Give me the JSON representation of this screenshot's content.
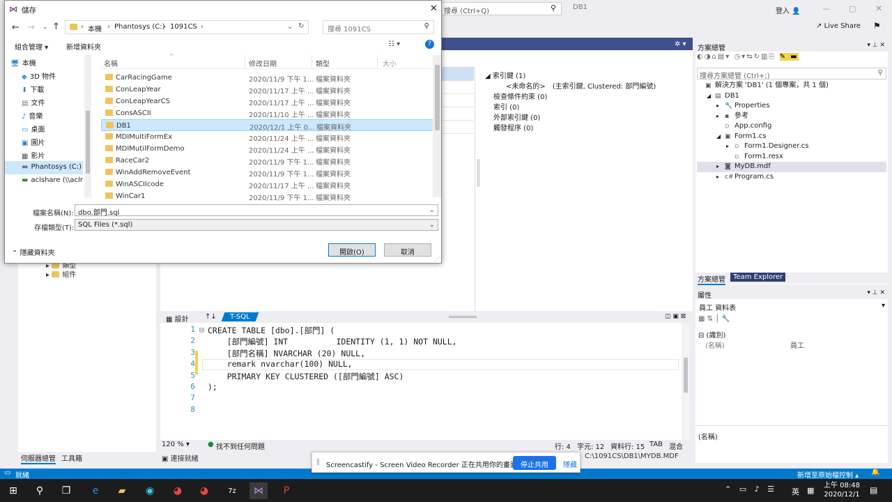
{
  "vs": {
    "search_placeholder": "搜尋 (Ctrl+Q)",
    "db_tab": "DB1",
    "login": "登入",
    "live_share": "Live Share",
    "left_tree": [
      "類型",
      "組件"
    ],
    "left_tabs": [
      "伺服器總管",
      "工具箱"
    ],
    "indexes": [
      "索引鍵 (1)",
      "<未命名的>　(主索引鍵, Clustered: 部門編號)",
      "檢查條件約束 (0)",
      "索引 (0)",
      "外部索引鍵 (0)",
      "觸發程序 (0)"
    ],
    "bottom_tabs": {
      "design": "設計",
      "swap": "↑↓",
      "tsql": "T-SQL"
    },
    "code_lines": [
      {
        "n": "1",
        "t": "CREATE TABLE [dbo].[部門] ("
      },
      {
        "n": "2",
        "t": "    [部門編號] INT          IDENTITY (1, 1) NOT NULL,"
      },
      {
        "n": "3",
        "t": "    [部門名稱] NVARCHAR (20) NULL,"
      },
      {
        "n": "4",
        "t": "    remark nvarchar(100) NULL,"
      },
      {
        "n": "5",
        "t": "    PRIMARY KEY CLUSTERED ([部門編號] ASC)"
      },
      {
        "n": "6",
        "t": ");"
      },
      {
        "n": "7",
        "t": ""
      },
      {
        "n": "8",
        "t": ""
      }
    ],
    "code_status": {
      "zoom": "120 %",
      "issues": "找不到任何問題",
      "line": "行: 4",
      "char": "字元: 12",
      "col": "資料行: 15",
      "tab": "TAB",
      "mixed": "混合"
    },
    "connect_ready": "連接就緒",
    "path": "C:\\1091CS\\DB1\\MYDB.MDF",
    "solution_title": "方案總管",
    "solution_search": "搜尋方案總管 (Ctrl+;)",
    "solution_tree": [
      {
        "label": "解決方案 'DB1' (1 個專案，共 1 個)",
        "lvl": 0
      },
      {
        "label": "DB1",
        "lvl": 1
      },
      {
        "label": "Properties",
        "lvl": 2
      },
      {
        "label": "參考",
        "lvl": 2
      },
      {
        "label": "App.config",
        "lvl": 2
      },
      {
        "label": "Form1.cs",
        "lvl": 2
      },
      {
        "label": "Form1.Designer.cs",
        "lvl": 3
      },
      {
        "label": "Form1.resx",
        "lvl": 3
      },
      {
        "label": "MyDB.mdf",
        "lvl": 2
      },
      {
        "label": "Program.cs",
        "lvl": 2
      }
    ],
    "solution_tabs": [
      "方案總管",
      "Team Explorer"
    ],
    "props_title": "屬性",
    "props_object": "員工 資料表",
    "props_category": "(識別)",
    "props_name_key": "(名稱)",
    "props_name_val": "員工",
    "props_desc": "(名稱)",
    "status": {
      "ready": "就緒",
      "add_source": "新增至原始檔控制"
    }
  },
  "dialog": {
    "title": "儲存",
    "breadcrumb": [
      "本機",
      "Phantosys (C:)",
      "1091CS"
    ],
    "search_placeholder": "搜尋 1091CS",
    "organize": "組合管理",
    "new_folder": "新增資料夾",
    "nav": [
      "本機",
      "3D 物件",
      "下載",
      "文件",
      "音樂",
      "桌面",
      "圖片",
      "影片",
      "Phantosys (C:)",
      "aclshare (\\\\acln"
    ],
    "columns": {
      "name": "名稱",
      "date": "修改日期",
      "type": "類型",
      "size": "大小"
    },
    "files": [
      {
        "name": "CarRacingGame",
        "date": "2020/11/9 下午 1...",
        "type": "檔案資料夾"
      },
      {
        "name": "ConLeapYear",
        "date": "2020/11/17 上午 ...",
        "type": "檔案資料夾"
      },
      {
        "name": "ConLeapYearCS",
        "date": "2020/11/17 上午 ...",
        "type": "檔案資料夾"
      },
      {
        "name": "ConsASCII",
        "date": "2020/11/10 上午 ...",
        "type": "檔案資料夾"
      },
      {
        "name": "DB1",
        "date": "2020/12/1 上午 0...",
        "type": "檔案資料夾"
      },
      {
        "name": "MDIMultiFormEx",
        "date": "2020/11/24 上午 ...",
        "type": "檔案資料夾"
      },
      {
        "name": "MDIMutilFormDemo",
        "date": "2020/11/24 上午 ...",
        "type": "檔案資料夾"
      },
      {
        "name": "RaceCar2",
        "date": "2020/11/9 下午 1...",
        "type": "檔案資料夾"
      },
      {
        "name": "WinAddRemoveEvent",
        "date": "2020/11/9 下午 1...",
        "type": "檔案資料夾"
      },
      {
        "name": "WinASCIIcode",
        "date": "2020/11/17 上午 ...",
        "type": "檔案資料夾"
      },
      {
        "name": "WinCar1",
        "date": "2020/11/9 下午 1...",
        "type": "檔案資料夾"
      }
    ],
    "filename_label": "檔案名稱(N):",
    "filename_value": "dbo.部門.sql",
    "filetype_label": "存檔類型(T):",
    "filetype_value": "SQL Files (*.sql)",
    "hide_folders": "隱藏資料夾",
    "open": "開啟(O)",
    "cancel": "取消"
  },
  "notification": {
    "text": "Screencastify - Screen Video Recorder 正在共用你的畫面。",
    "stop": "停止共用",
    "hide": "隱藏"
  },
  "taskbar": {
    "lang": "英",
    "time": "上午 08:48",
    "date": "2020/12/1"
  }
}
